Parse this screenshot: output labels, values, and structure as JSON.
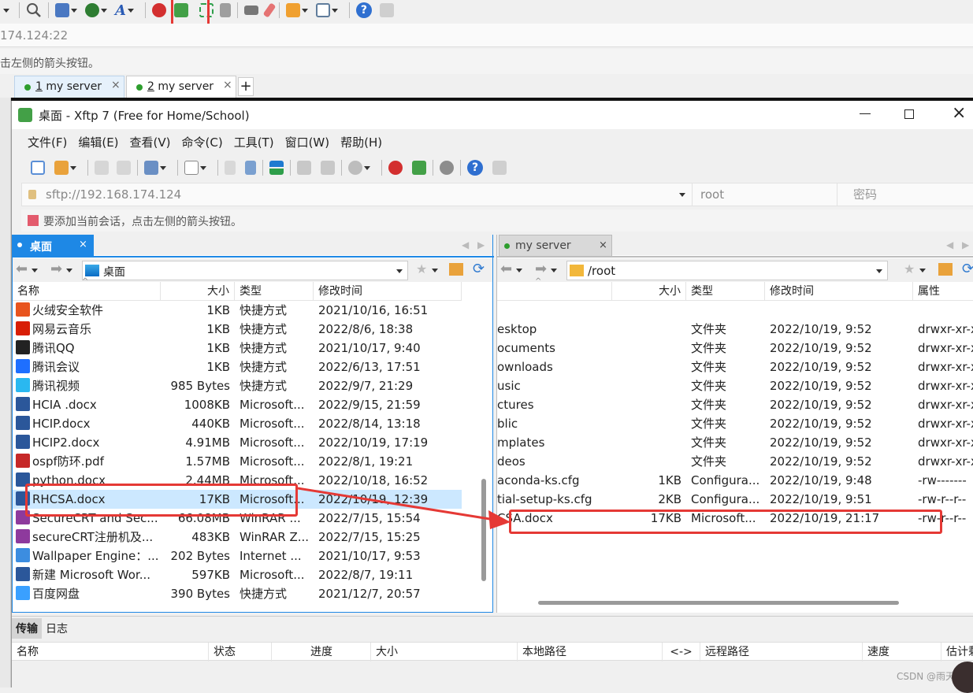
{
  "outer": {
    "address": "174.124:22",
    "hint": "击左侧的箭头按钮。",
    "tabs": [
      {
        "num": "1",
        "label": " my server"
      },
      {
        "num": "2",
        "label": " my server"
      }
    ],
    "add_tab": "+"
  },
  "xftp": {
    "title": "桌面 - Xftp 7 (Free for Home/School)",
    "menu": [
      "文件(F)",
      "编辑(E)",
      "查看(V)",
      "命令(C)",
      "工具(T)",
      "窗口(W)",
      "帮助(H)"
    ],
    "address": "sftp://192.168.174.124",
    "user": "root",
    "password_placeholder": "密码",
    "hint": "要添加当前会话，点击左侧的箭头按钮。",
    "left": {
      "tab": "桌面",
      "path": "桌面",
      "headers": [
        "名称",
        "大小",
        "类型",
        "修改时间"
      ],
      "files": [
        {
          "name": "火绒安全软件",
          "size": "1KB",
          "type": "快捷方式",
          "mtime": "2021/10/16, 16:51",
          "icon": "huorong-icon",
          "color": "#e8541e"
        },
        {
          "name": "网易云音乐",
          "size": "1KB",
          "type": "快捷方式",
          "mtime": "2022/8/6, 18:38",
          "icon": "netease-music-icon",
          "color": "#d81e06"
        },
        {
          "name": "腾讯QQ",
          "size": "1KB",
          "type": "快捷方式",
          "mtime": "2021/10/17, 9:40",
          "icon": "qq-icon",
          "color": "#222222"
        },
        {
          "name": "腾讯会议",
          "size": "1KB",
          "type": "快捷方式",
          "mtime": "2022/6/13, 17:51",
          "icon": "tencent-meeting-icon",
          "color": "#1e6fff"
        },
        {
          "name": "腾讯视频",
          "size": "985 Bytes",
          "type": "快捷方式",
          "mtime": "2022/9/7, 21:29",
          "icon": "tencent-video-icon",
          "color": "#2ab8f0"
        },
        {
          "name": "HCIA .docx",
          "size": "1008KB",
          "type": "Microsoft...",
          "mtime": "2022/9/15, 21:59",
          "icon": "word-doc-icon",
          "color": "#2b579a"
        },
        {
          "name": "HCIP.docx",
          "size": "440KB",
          "type": "Microsoft...",
          "mtime": "2022/8/14, 13:18",
          "icon": "word-doc-icon",
          "color": "#2b579a"
        },
        {
          "name": "HCIP2.docx",
          "size": "4.91MB",
          "type": "Microsoft...",
          "mtime": "2022/10/19, 17:19",
          "icon": "word-doc-icon",
          "color": "#2b579a"
        },
        {
          "name": "ospf防环.pdf",
          "size": "1.57MB",
          "type": "Microsoft...",
          "mtime": "2022/8/1, 19:21",
          "icon": "pdf-icon",
          "color": "#c62828"
        },
        {
          "name": "python.docx",
          "size": "2.44MB",
          "type": "Microsoft...",
          "mtime": "2022/10/18, 16:52",
          "icon": "word-doc-icon",
          "color": "#2b579a"
        },
        {
          "name": "RHCSA.docx",
          "size": "17KB",
          "type": "Microsoft...",
          "mtime": "2022/10/19, 12:39",
          "icon": "word-doc-icon",
          "color": "#2b579a",
          "selected": true
        },
        {
          "name": "SecureCRT and Sec...",
          "size": "66.08MB",
          "type": "WinRAR ...",
          "mtime": "2022/7/15, 15:54",
          "icon": "winrar-icon",
          "color": "#8e3a9d"
        },
        {
          "name": "secureCRT注册机及...",
          "size": "483KB",
          "type": "WinRAR Z...",
          "mtime": "2022/7/15, 15:25",
          "icon": "winrar-icon",
          "color": "#8e3a9d"
        },
        {
          "name": "Wallpaper Engine：...",
          "size": "202 Bytes",
          "type": "Internet ...",
          "mtime": "2021/10/17, 9:53",
          "icon": "internet-shortcut-icon",
          "color": "#3c8de0"
        },
        {
          "name": "新建 Microsoft Wor...",
          "size": "597KB",
          "type": "Microsoft...",
          "mtime": "2022/8/7, 19:11",
          "icon": "word-doc-icon",
          "color": "#2b579a"
        },
        {
          "name": "百度网盘",
          "size": "390 Bytes",
          "type": "快捷方式",
          "mtime": "2021/12/7, 20:57",
          "icon": "baidu-netdisk-icon",
          "color": "#3aa0ff"
        }
      ]
    },
    "right": {
      "tab": "my server",
      "path": "/root",
      "headers": [
        "大小",
        "类型",
        "修改时间",
        "属性"
      ],
      "files": [
        {
          "name": "esktop",
          "size": "",
          "type": "文件夹",
          "mtime": "2022/10/19, 9:52",
          "perm": "drwxr-xr-x"
        },
        {
          "name": "ocuments",
          "size": "",
          "type": "文件夹",
          "mtime": "2022/10/19, 9:52",
          "perm": "drwxr-xr-x"
        },
        {
          "name": "ownloads",
          "size": "",
          "type": "文件夹",
          "mtime": "2022/10/19, 9:52",
          "perm": "drwxr-xr-x"
        },
        {
          "name": "usic",
          "size": "",
          "type": "文件夹",
          "mtime": "2022/10/19, 9:52",
          "perm": "drwxr-xr-x"
        },
        {
          "name": "ctures",
          "size": "",
          "type": "文件夹",
          "mtime": "2022/10/19, 9:52",
          "perm": "drwxr-xr-x"
        },
        {
          "name": "blic",
          "size": "",
          "type": "文件夹",
          "mtime": "2022/10/19, 9:52",
          "perm": "drwxr-xr-x"
        },
        {
          "name": "mplates",
          "size": "",
          "type": "文件夹",
          "mtime": "2022/10/19, 9:52",
          "perm": "drwxr-xr-x"
        },
        {
          "name": "deos",
          "size": "",
          "type": "文件夹",
          "mtime": "2022/10/19, 9:52",
          "perm": "drwxr-xr-x"
        },
        {
          "name": "aconda-ks.cfg",
          "size": "1KB",
          "type": "Configura...",
          "mtime": "2022/10/19, 9:48",
          "perm": "-rw-------"
        },
        {
          "name": "tial-setup-ks.cfg",
          "size": "2KB",
          "type": "Configura...",
          "mtime": "2022/10/19, 9:51",
          "perm": "-rw-r--r--"
        },
        {
          "name": "CSA.docx",
          "size": "17KB",
          "type": "Microsoft...",
          "mtime": "2022/10/19, 21:17",
          "perm": "-rw-r--r--"
        }
      ]
    },
    "bottom": {
      "tabs": [
        "传输",
        "日志"
      ],
      "headers": [
        "名称",
        "状态",
        "进度",
        "大小",
        "本地路径",
        "<->",
        "远程路径",
        "速度",
        "估计剩"
      ]
    }
  },
  "watermark": "CSDN @雨天",
  "colors": {
    "accent": "#1e88e5",
    "selection": "#cce8ff",
    "annotation": "#e53935"
  }
}
